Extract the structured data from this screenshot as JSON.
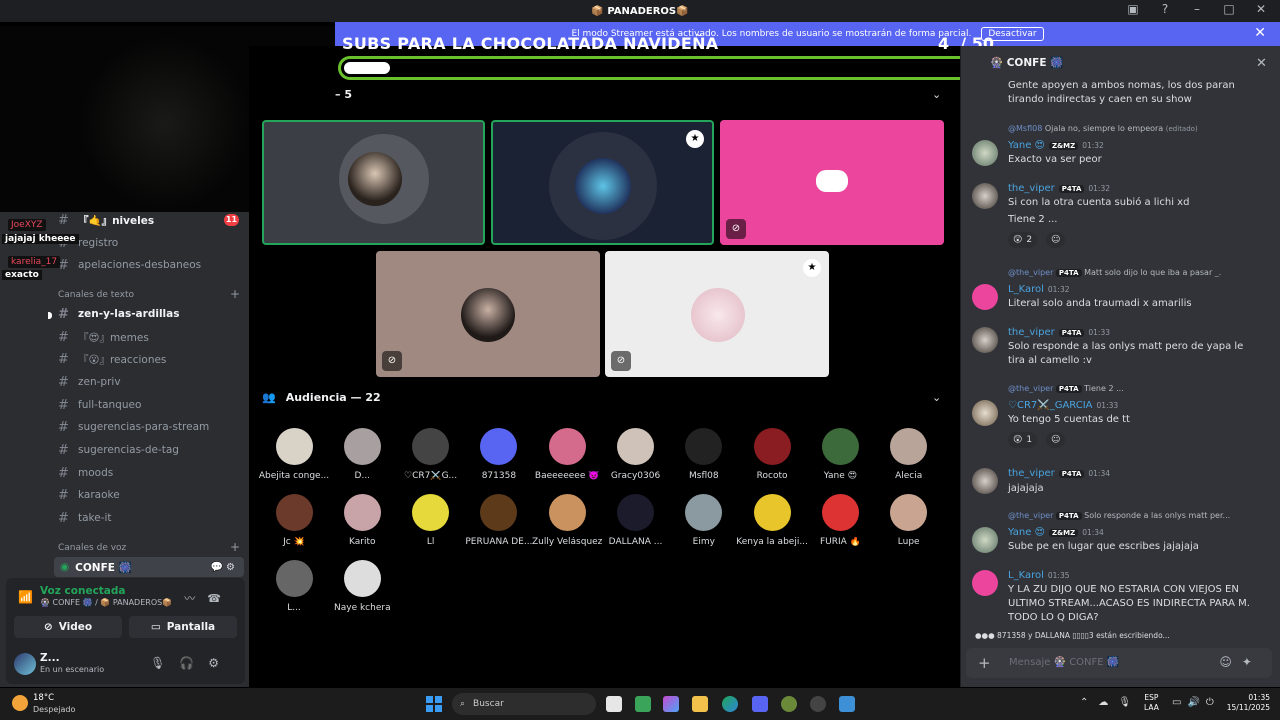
{
  "window": {
    "title": "📦 PANADEROS📦"
  },
  "banner": {
    "text": "El modo Streamer está activado. Los nombres de usuario se mostrarán de forma parcial.",
    "button": "Desactivar"
  },
  "stream_overlay": {
    "messages": [
      {
        "name": "JoeXYZ",
        "text": "jajajaj kheeee",
        "color": "#e8475c"
      },
      {
        "name": "karelia_17",
        "text": "exacto",
        "color": "#e8475c"
      }
    ]
  },
  "sidebar": {
    "channels_top": [
      {
        "label": "『🤙』niveles",
        "badge": "11"
      },
      {
        "label": "registro"
      },
      {
        "label": "apelaciones-desbaneos"
      }
    ],
    "text_section": "Canales de texto",
    "text_channels": [
      {
        "label": "zen-y-las-ardillas",
        "active": true
      },
      {
        "label": "『😍』memes"
      },
      {
        "label": "『😮』reacciones"
      },
      {
        "label": "zen-priv"
      },
      {
        "label": "full-tanqueo"
      },
      {
        "label": "sugerencias-para-stream"
      },
      {
        "label": "sugerencias-de-tag"
      },
      {
        "label": "moods"
      },
      {
        "label": "karaoke"
      },
      {
        "label": "take-it"
      }
    ],
    "voice_section": "Canales de voz",
    "voice_channel": "CONFE 🎆"
  },
  "voice_panel": {
    "status": "Voz conectada",
    "path": "🎡 CONFE 🎆 / 📦 PANADEROS📦",
    "video_label": "Video",
    "screen_label": "Pantalla",
    "user_name": "Z...",
    "user_status": "En un escenario"
  },
  "stage": {
    "title": "SUBS PARA LA CHOCOLATADA NAVIDEÑA",
    "count": "4",
    "total": "/ 50",
    "progress_fraction": 0.08,
    "speakers_header": "– 5",
    "audience_header": "Audiencia — 22",
    "audience": [
      "Abejita conge...",
      "D...",
      "♡CR7⚔️G...",
      "871358",
      "Baeeeeeee 👿",
      "Gracy0306",
      "Msfl08",
      "Rocoto",
      "Yane 😍",
      "Alecia",
      "Jc 💥",
      "Karito",
      "Ll",
      "PERUANA DE...",
      "Zully Velásquez",
      "DALLANA ...",
      "Eimy",
      "Kenya la abeji...",
      "FURIA 🔥",
      "Lupe",
      "L...",
      "Naye kchera"
    ]
  },
  "chat": {
    "header": "🎡 CONFE 🎆",
    "first_text": "Gente apoyen a ambos nomas, los dos paran tirando indirectas y caen en su show",
    "messages": [
      {
        "reply_name": "@Msfl08",
        "reply_text": "Ojala no, siempre lo empeora",
        "reply_edited": "(editado)",
        "author": "Yane 😍",
        "tag": "Z&MZ",
        "time": "01:32",
        "text": "Exacto va ser peor"
      },
      {
        "author": "the_viper",
        "tag": "P4TA",
        "time": "01:32",
        "text": "Si con la otra cuenta subió a lichi xd",
        "text2": "Tiene 2 ...",
        "reaction_count": "2"
      },
      {
        "reply_name": "@the_viper",
        "reply_tag": "P4TA",
        "reply_text": "Matt solo dijo lo que iba a pasar _.",
        "author": "L_Karol",
        "time": "01:32",
        "text": "Literal solo anda traumadi x amarilis"
      },
      {
        "author": "the_viper",
        "tag": "P4TA",
        "time": "01:33",
        "text": "Solo responde a las onlys matt pero de yapa le tira al camello :v"
      },
      {
        "reply_name": "@the_viper",
        "reply_tag": "P4TA",
        "reply_text": "Tiene 2 ...",
        "author": "♡CR7⚔️_GARCIA",
        "time": "01:33",
        "text": "Yo tengo 5 cuentas de tt",
        "reaction_count": "1"
      },
      {
        "author": "the_viper",
        "tag": "P4TA",
        "time": "01:34",
        "text": "jajajaja"
      },
      {
        "reply_name": "@the_viper",
        "reply_tag": "P4TA",
        "reply_text": "Solo responde a las onlys matt per...",
        "author": "Yane 😍",
        "tag": "Z&MZ",
        "time": "01:34",
        "text": "Sube pe en lugar que escribes jajajaja"
      },
      {
        "author": "L_Karol",
        "time": "01:35",
        "text": "Y LA ZU DIJO QUE NO ESTARIA CON VIEJOS EN ULTIMO STREAM...ACASO ES INDIRECTA PARA M. TODO LO Q DIGA?"
      }
    ],
    "typing": "871358 y DALLANA ▯▯▯▯3 están escribiendo...",
    "composer_placeholder": "Mensaje 🎡 CONFE 🎆"
  },
  "taskbar": {
    "temp": "18°C",
    "weather": "Despejado",
    "search": "Buscar",
    "lang1": "ESP",
    "lang2": "LAA",
    "time": "01:35",
    "date": "15/11/2025"
  },
  "colors": {
    "accent": "#5865f2",
    "progress": "#6ac02a",
    "online": "#23a55a",
    "pink_tile": "#eb459e"
  }
}
